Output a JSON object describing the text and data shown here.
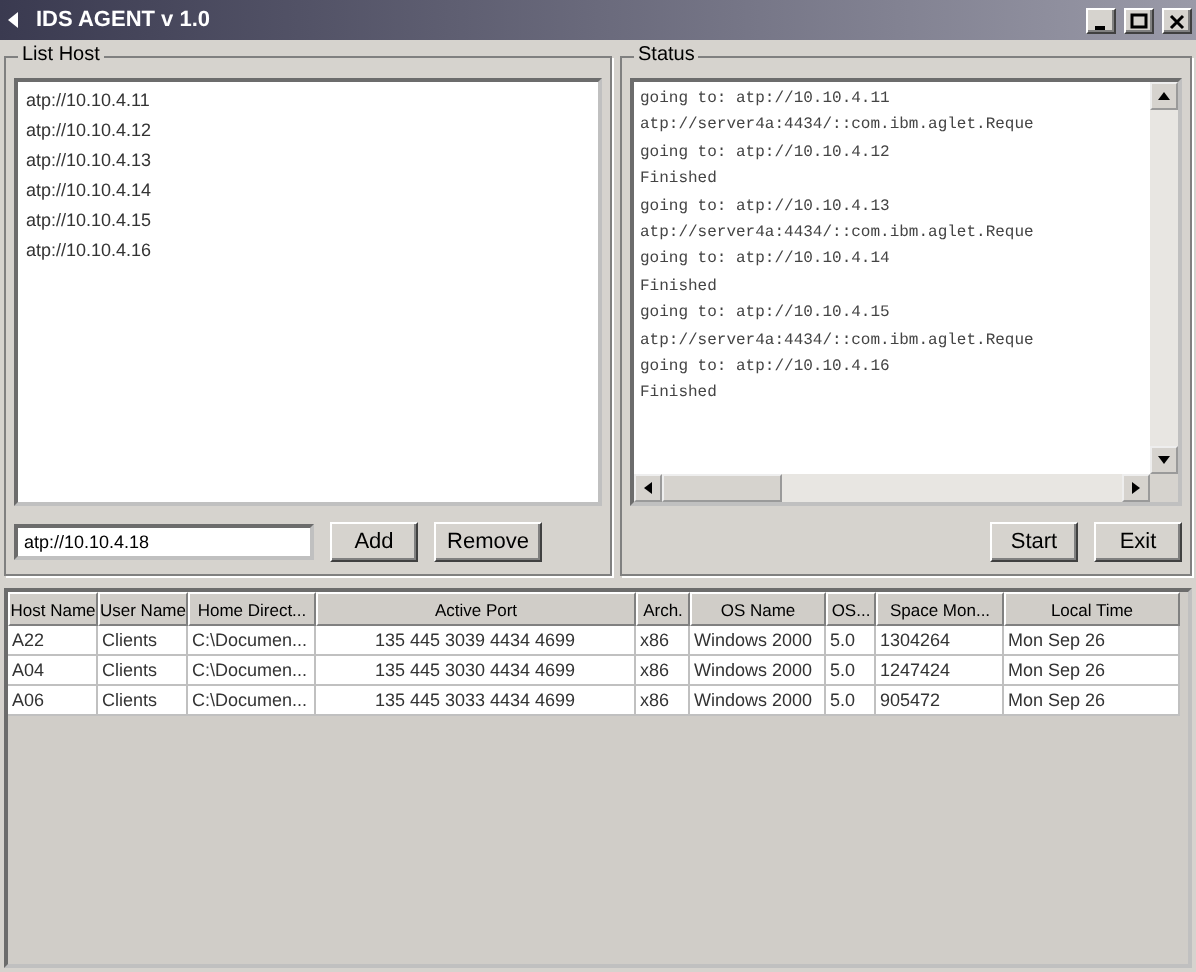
{
  "window": {
    "title": "IDS AGENT v 1.0"
  },
  "list_host": {
    "label": "List Host",
    "items": [
      {
        "text": "atp://10.10.4.11",
        "selected": false
      },
      {
        "text": "atp://10.10.4.12",
        "selected": false
      },
      {
        "text": "atp://10.10.4.13",
        "selected": false
      },
      {
        "text": "atp://10.10.4.14",
        "selected": false
      },
      {
        "text": "atp://10.10.4.15",
        "selected": false
      },
      {
        "text": "atp://10.10.4.16",
        "selected": false
      }
    ],
    "input": {
      "value": "atp://10.10.4.18"
    },
    "buttons": [
      "Add",
      "Remove"
    ]
  },
  "status": {
    "label": "Status",
    "lines": [
      "going to: atp://10.10.4.11",
      "atp://server4a:4434/::com.ibm.aglet.Reque",
      "going to: atp://10.10.4.12",
      "Finished",
      "going to: atp://10.10.4.13",
      "atp://server4a:4434/::com.ibm.aglet.Reque",
      "going to: atp://10.10.4.14",
      "Finished",
      "going to: atp://10.10.4.15",
      "atp://server4a:4434/::com.ibm.aglet.Reque",
      "going to: atp://10.10.4.16",
      "Finished"
    ],
    "buttons": [
      "Start",
      "Exit"
    ]
  },
  "table": {
    "columns": [
      "Host Name",
      "User Name",
      "Home Direct...",
      "Active Port",
      "Arch.",
      "OS Name",
      "OS...",
      "Space Mon...",
      "Local Time"
    ],
    "rows": [
      [
        "A22",
        "Clients",
        "C:\\Documen...",
        "135 445 3039 4434 4699",
        "x86",
        "Windows 2000",
        "5.0",
        "1304264",
        "Mon Sep 26"
      ],
      [
        "A04",
        "Clients",
        "C:\\Documen...",
        "135 445 3030 4434 4699",
        "x86",
        "Windows 2000",
        "5.0",
        "1247424",
        "Mon Sep 26"
      ],
      [
        "A06",
        "Clients",
        "C:\\Documen...",
        "135 445 3033 4434 4699",
        "x86",
        "Windows 2000",
        "5.0",
        "905472",
        "Mon Sep 26"
      ]
    ]
  }
}
